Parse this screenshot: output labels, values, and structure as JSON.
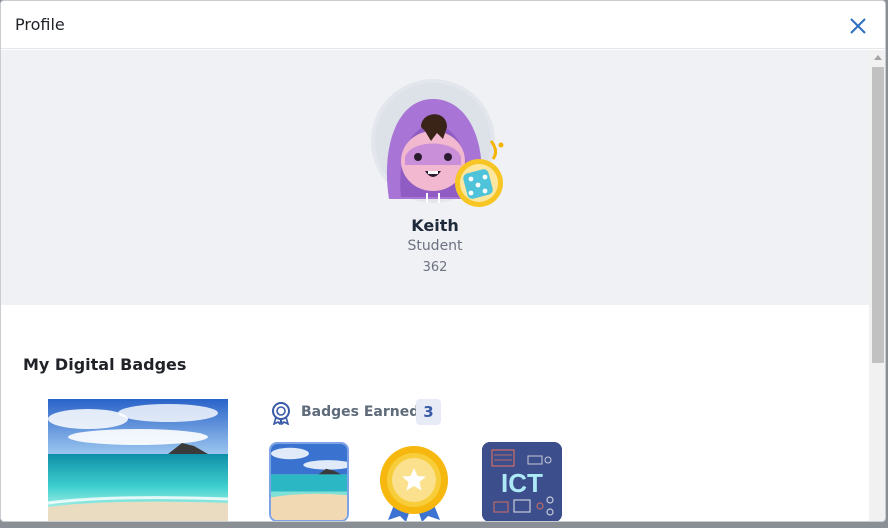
{
  "dialog": {
    "title": "Profile"
  },
  "profile": {
    "name": "Keith",
    "role": "Student",
    "points": "362"
  },
  "badges_section": {
    "title": "My Digital Badges",
    "earned_label": "Badges Earned",
    "earned_count": "3",
    "badges": [
      {
        "icon": "beach-badge"
      },
      {
        "icon": "gold-star-medal-badge"
      },
      {
        "icon": "ict-badge",
        "text": "ICT"
      }
    ]
  },
  "colors": {
    "accent": "#2f6fbf",
    "panel_bg": "#f0f1f4",
    "avatar_purple": "#a874d6"
  }
}
